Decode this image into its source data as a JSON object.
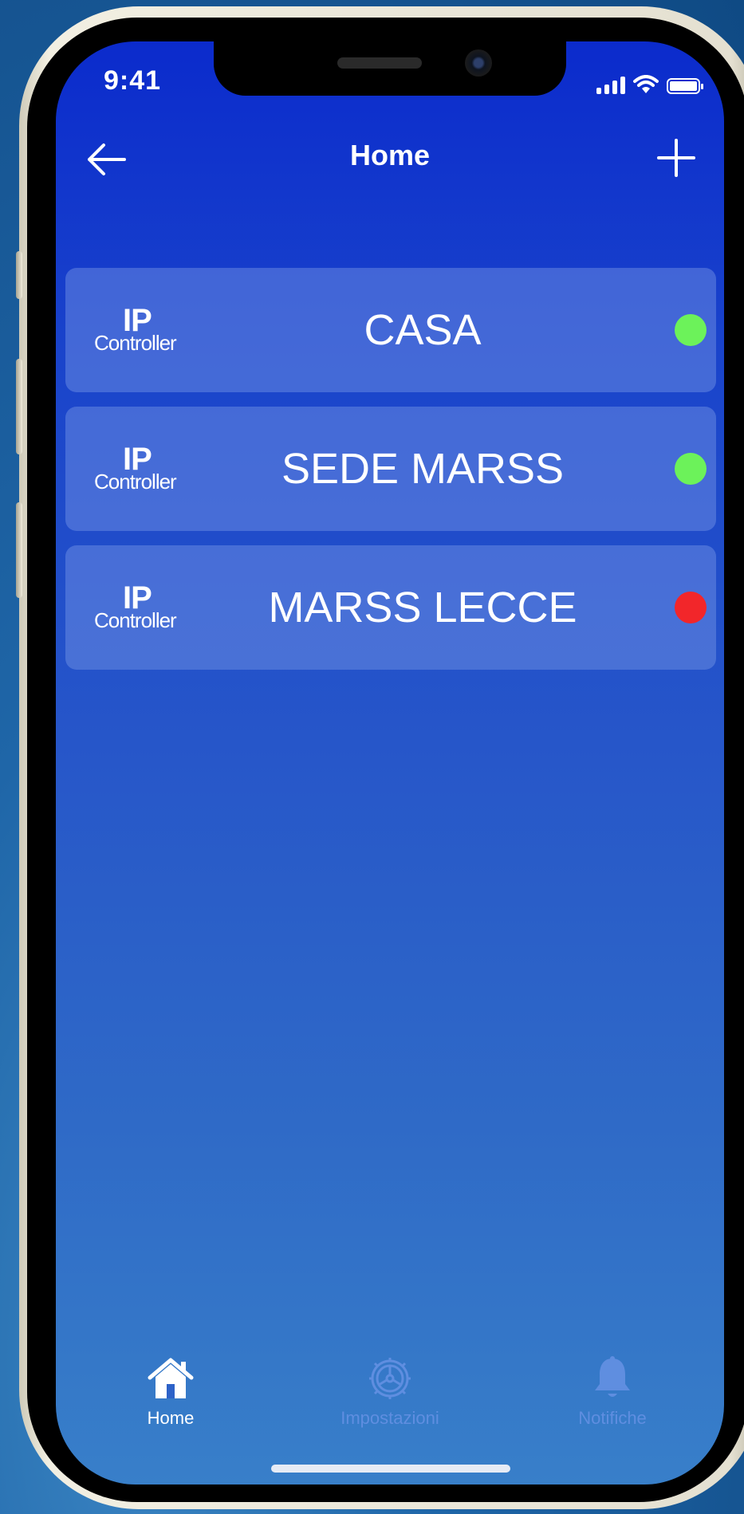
{
  "status_bar": {
    "time": "9:41"
  },
  "nav": {
    "title": "Home"
  },
  "devices": [
    {
      "logo_top": "IP",
      "logo_bottom": "Controller",
      "name": "CASA",
      "status_color": "#6cf25a"
    },
    {
      "logo_top": "IP",
      "logo_bottom": "Controller",
      "name": "SEDE MARSS",
      "status_color": "#6cf25a"
    },
    {
      "logo_top": "IP",
      "logo_bottom": "Controller",
      "name": "MARSS LECCE",
      "status_color": "#f2262a"
    }
  ],
  "tabs": [
    {
      "label": "Home",
      "icon": "house-icon",
      "active": true
    },
    {
      "label": "Impostazioni",
      "icon": "gear-icon",
      "active": false
    },
    {
      "label": "Notifiche",
      "icon": "bell-icon",
      "active": false
    }
  ],
  "colors": {
    "screen_top": "#0b2bcc",
    "screen_bottom": "#387fc9",
    "online": "#6cf25a",
    "offline": "#f2262a",
    "tab_inactive": "#5f8ee0"
  }
}
